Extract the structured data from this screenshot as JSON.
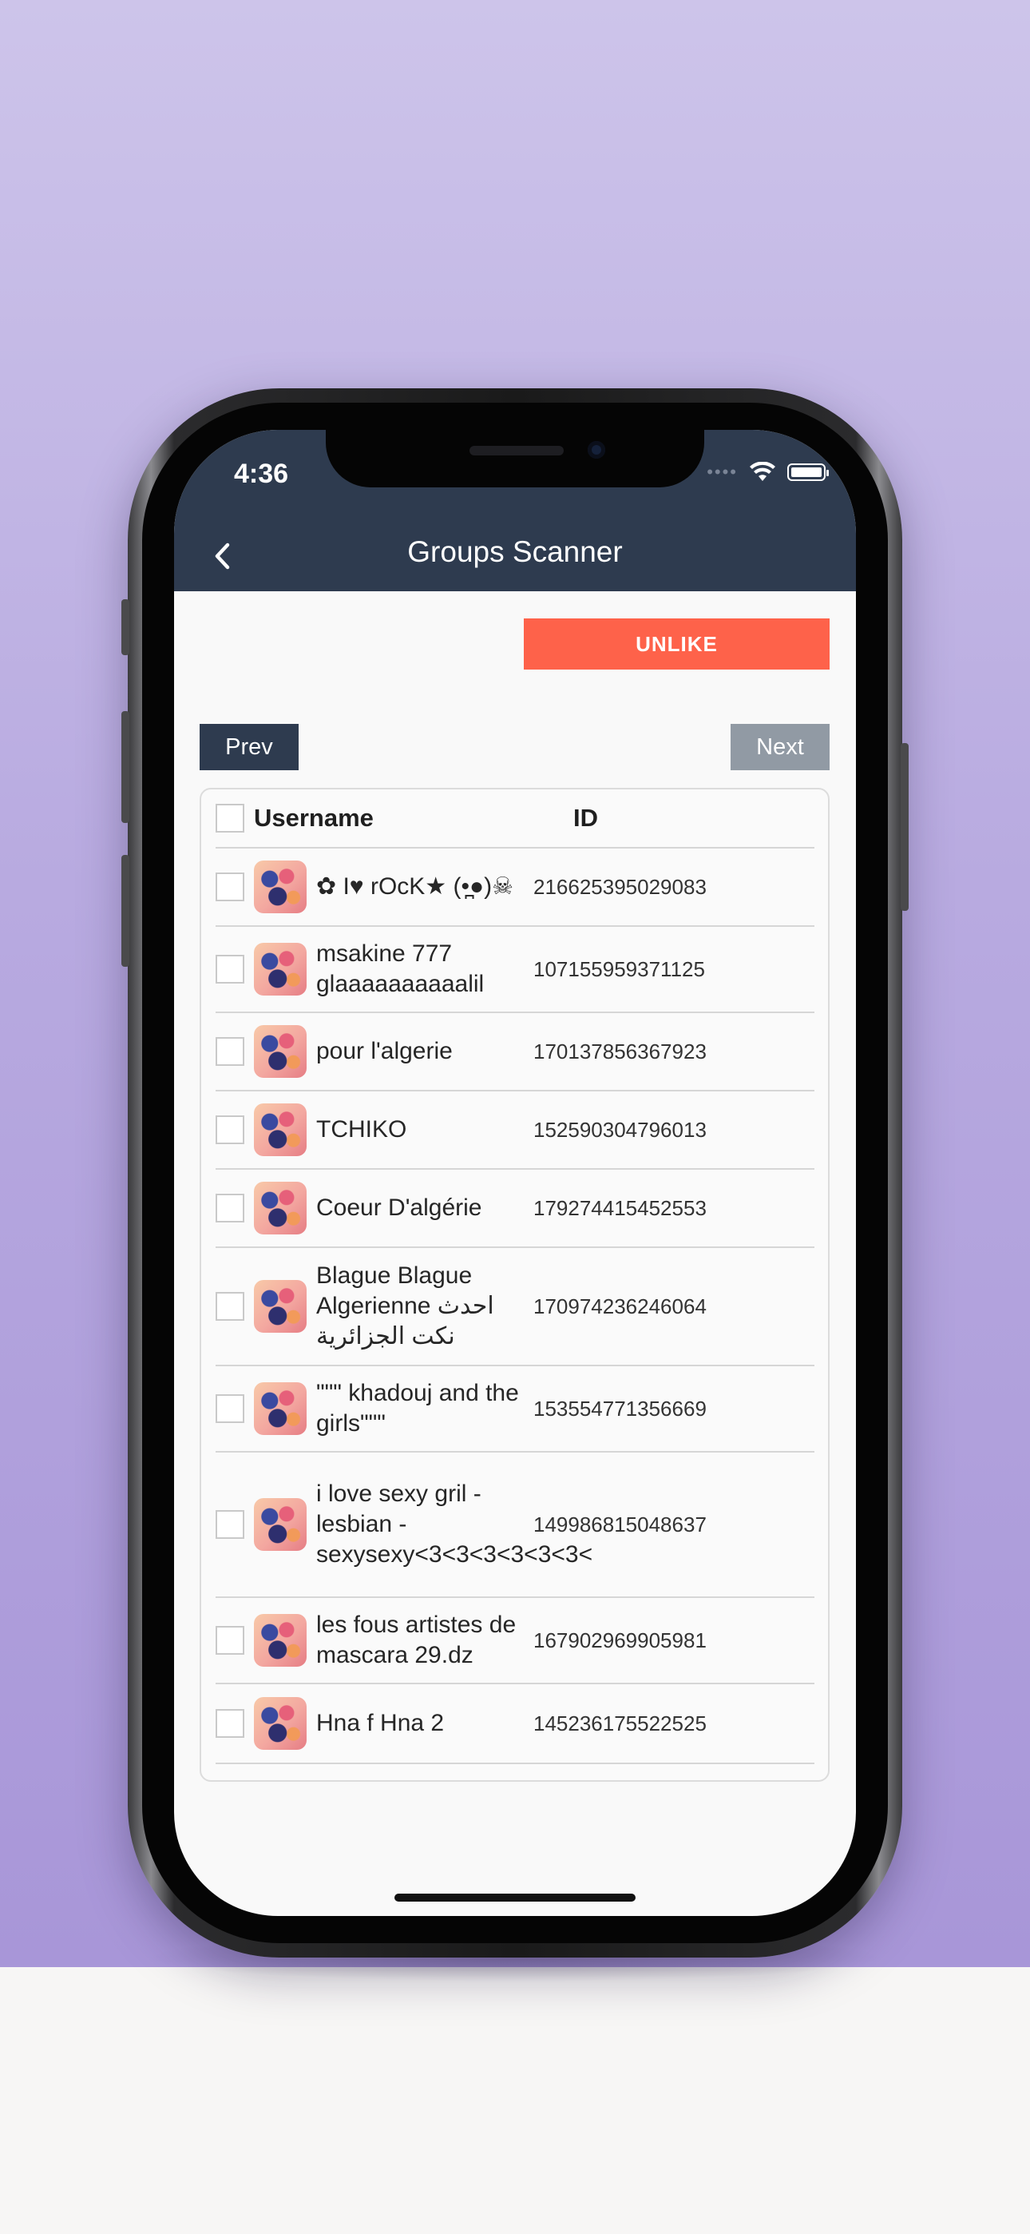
{
  "status_bar": {
    "time": "4:36"
  },
  "app_bar": {
    "title": "Groups Scanner",
    "back_icon": "chevron-left-icon"
  },
  "actions": {
    "unlike_label": "UNLIKE",
    "prev_label": "Prev",
    "next_label": "Next"
  },
  "colors": {
    "app_bar": "#2e3b4f",
    "unlike": "#fe624a",
    "next_disabled": "#919aa4"
  },
  "table": {
    "headers": {
      "username": "Username",
      "id": "ID"
    },
    "rows": [
      {
        "username": "✿ I♥ rOcK★ (•̪●)☠",
        "id": "216625395029083"
      },
      {
        "username": "msakine 777 glaaaaaaaaaalil",
        "id": "107155959371125"
      },
      {
        "username": "pour l'algerie",
        "id": "170137856367923"
      },
      {
        "username": "TCHIKO",
        "id": "152590304796013"
      },
      {
        "username": "Coeur D'algérie",
        "id": "179274415452553"
      },
      {
        "username": "Blague Blague Algerienne احدث نكت الجزائرية",
        "id": "170974236246064"
      },
      {
        "username": "\"\"\" khadouj and the girls\"\"\"",
        "id": "153554771356669"
      },
      {
        "username": "i love sexy gril - lesbian - sexysexy<3<3<3<3<3<3<",
        "id": "149986815048637"
      },
      {
        "username": "les fous artistes de mascara  29.dz",
        "id": "167902969905981"
      },
      {
        "username": "Hna f Hna 2",
        "id": "145236175522525"
      }
    ]
  }
}
